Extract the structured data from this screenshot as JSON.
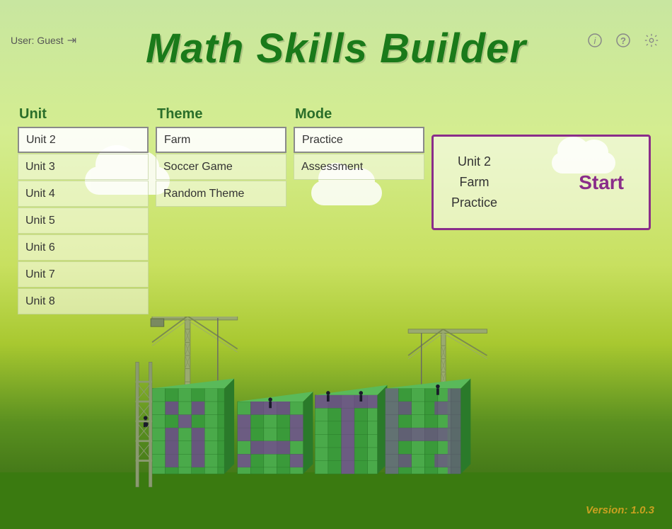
{
  "app": {
    "title": "Math Skills Builder",
    "version": "Version: 1.0.3"
  },
  "user": {
    "label": "User: Guest",
    "logout_icon": "⇥"
  },
  "header_icons": {
    "info": "i",
    "help": "?",
    "settings": "⚙"
  },
  "unit_column": {
    "header": "Unit",
    "items": [
      {
        "label": "Unit 2",
        "selected": true
      },
      {
        "label": "Unit 3",
        "selected": false
      },
      {
        "label": "Unit 4",
        "selected": false
      },
      {
        "label": "Unit 5",
        "selected": false
      },
      {
        "label": "Unit 6",
        "selected": false
      },
      {
        "label": "Unit 7",
        "selected": false
      },
      {
        "label": "Unit 8",
        "selected": false
      }
    ]
  },
  "theme_column": {
    "header": "Theme",
    "items": [
      {
        "label": "Farm",
        "selected": true
      },
      {
        "label": "Soccer Game",
        "selected": false
      },
      {
        "label": "Random Theme",
        "selected": false
      }
    ]
  },
  "mode_column": {
    "header": "Mode",
    "items": [
      {
        "label": "Practice",
        "selected": true
      },
      {
        "label": "Assessment",
        "selected": false
      }
    ]
  },
  "start_panel": {
    "line1": "Unit 2",
    "line2": "Farm",
    "line3": "Practice",
    "button_label": "Start"
  }
}
